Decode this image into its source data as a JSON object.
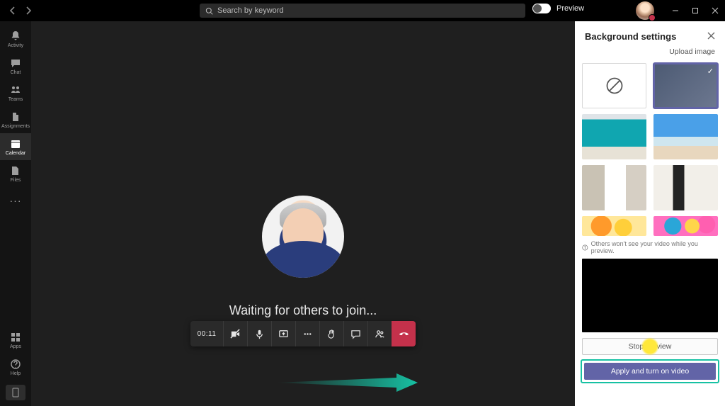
{
  "titlebar": {
    "search_placeholder": "Search by keyword",
    "preview_label": "Preview"
  },
  "leftbar": {
    "items": [
      {
        "key": "activity",
        "label": "Activity"
      },
      {
        "key": "chat",
        "label": "Chat"
      },
      {
        "key": "teams",
        "label": "Teams"
      },
      {
        "key": "assignments",
        "label": "Assignments"
      },
      {
        "key": "calendar",
        "label": "Calendar"
      },
      {
        "key": "files",
        "label": "Files"
      }
    ],
    "bottom": [
      {
        "key": "apps",
        "label": "Apps"
      },
      {
        "key": "help",
        "label": "Help"
      }
    ]
  },
  "meeting": {
    "waiting_text": "Waiting for others to join...",
    "timer": "00:11"
  },
  "panel": {
    "title": "Background settings",
    "upload_label": "Upload image",
    "info_text": "Others won't see your video while you preview.",
    "stop_label": "Stop preview",
    "apply_label": "Apply and turn on video"
  }
}
